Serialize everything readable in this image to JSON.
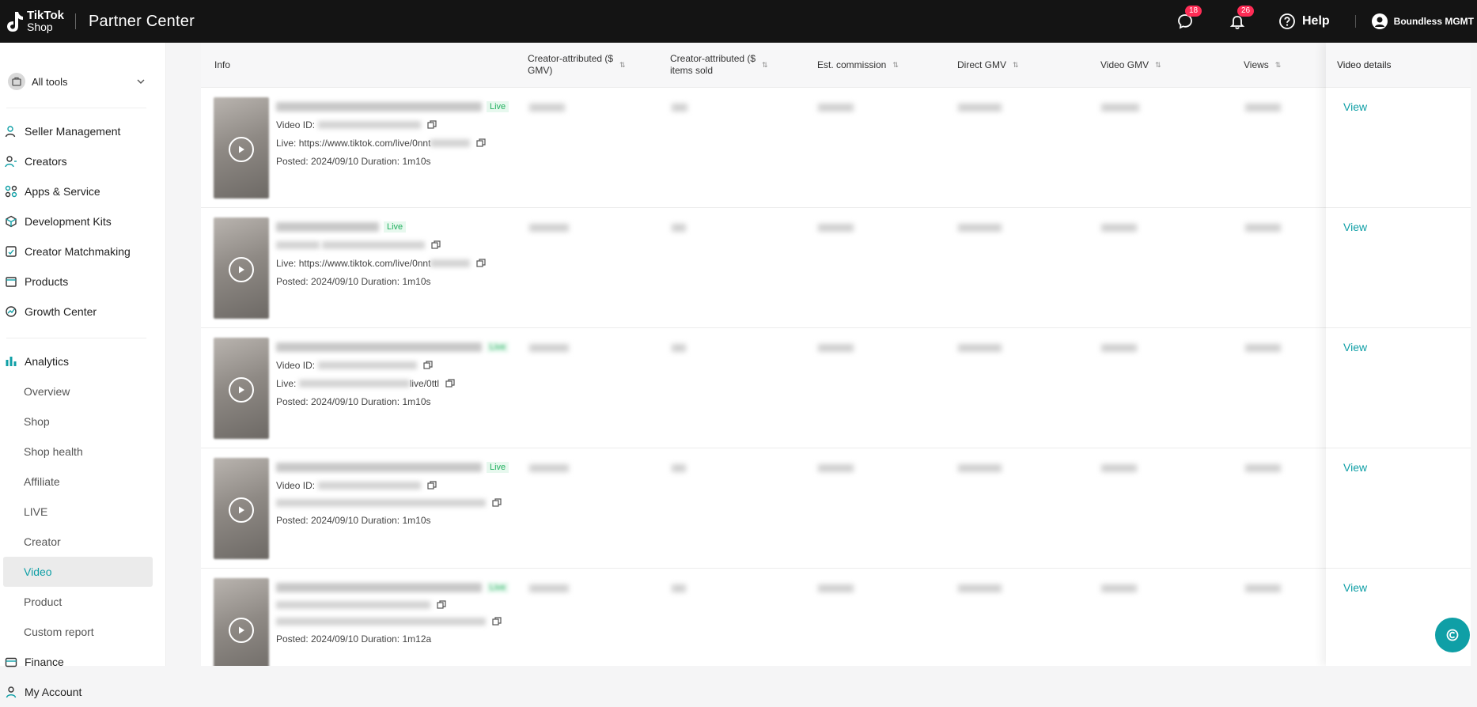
{
  "topbar": {
    "logo_line1": "TikTok",
    "logo_line2": "Shop",
    "app_title": "Partner Center",
    "messages_badge": "18",
    "notifications_badge": "26",
    "help_label": "Help",
    "user_name": "Boundless MGMT"
  },
  "sidebar": {
    "all_tools": "All tools",
    "items": [
      {
        "label": "Seller Management",
        "icon": "user-icon"
      },
      {
        "label": "Creators",
        "icon": "creators-icon"
      },
      {
        "label": "Apps & Service",
        "icon": "apps-icon"
      },
      {
        "label": "Development Kits",
        "icon": "cube-icon"
      },
      {
        "label": "Creator Matchmaking",
        "icon": "matchmaking-icon"
      },
      {
        "label": "Products",
        "icon": "box-icon"
      },
      {
        "label": "Growth Center",
        "icon": "growth-icon"
      }
    ],
    "analytics": {
      "label": "Analytics",
      "sub": [
        "Overview",
        "Shop",
        "Shop health",
        "Affiliate",
        "LIVE",
        "Creator",
        "Video",
        "Product",
        "Custom report"
      ],
      "active": "Video"
    },
    "finance": "Finance",
    "my_account": "My Account"
  },
  "table": {
    "headers": {
      "info": "Info",
      "creator_gmv_line1": "Creator-attributed ($",
      "creator_gmv_line2": "GMV)",
      "items_sold_line1": "Creator-attributed ($",
      "items_sold_line2": "items sold",
      "commission": "Est. commission",
      "direct_gmv": "Direct GMV",
      "video_gmv": "Video GMV",
      "views": "Views",
      "video_details": "Video details"
    },
    "video_id_label": "Video ID:",
    "live_label": "Live:",
    "posted_label": "Posted:",
    "duration_label": "Duration:",
    "live_tag": "Live",
    "view_link": "View",
    "rows": [
      {
        "live_url": "https://www.tiktok.com/live/0nnt",
        "posted": "2024/09/10",
        "duration": "1m10s"
      },
      {
        "live_url": "https://www.tiktok.com/live/0nnt",
        "posted": "2024/09/10",
        "duration": "1m10s"
      },
      {
        "live_url": "live/0ttl",
        "posted": "2024/09/10",
        "duration": "1m10s"
      },
      {
        "live_url": "",
        "posted": "2024/09/10",
        "duration": "1m10s"
      },
      {
        "live_url": "",
        "posted": "2024/09/10",
        "duration": "1m12a"
      }
    ]
  },
  "colors": {
    "accent": "#0f9fa6",
    "topbar": "#141414",
    "badge": "#fe2c55",
    "live_green": "#22b05f"
  }
}
